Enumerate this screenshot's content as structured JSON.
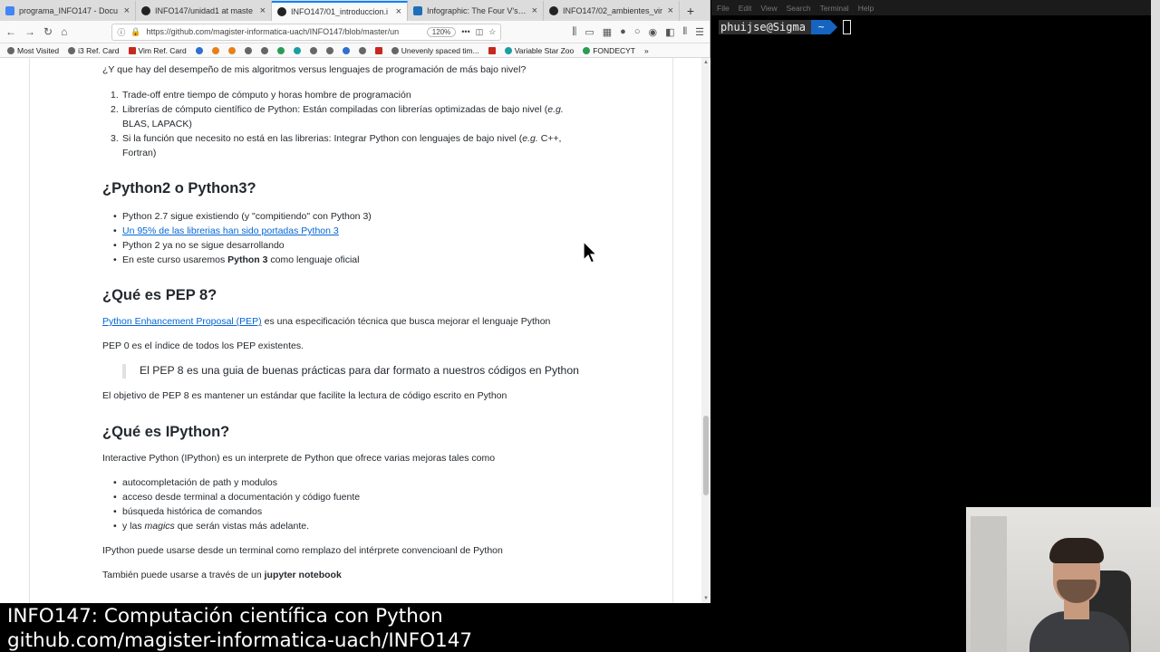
{
  "browser": {
    "tabs": [
      {
        "label": "programa_INFO147 - Docu",
        "favicon": "google-docs-icon",
        "active": false
      },
      {
        "label": "INFO147/unidad1 at maste",
        "favicon": "github-icon",
        "active": false
      },
      {
        "label": "INFO147/01_introduccion.i",
        "favicon": "github-icon",
        "active": true
      },
      {
        "label": "Infographic: The Four V's of",
        "favicon": "infographic-icon",
        "active": false
      },
      {
        "label": "INFO147/02_ambientes_vir",
        "favicon": "github-icon",
        "active": false
      }
    ],
    "new_tab": "+",
    "close_glyph": "×",
    "url": "https://github.com/magister-informatica-uach/INFO147/blob/master/un",
    "zoom": "120%",
    "bookmarks": [
      {
        "label": "Most Visited",
        "icon": "gear-icon"
      },
      {
        "label": "i3 Ref. Card",
        "icon": "globe-icon"
      },
      {
        "label": "Vim Ref. Card",
        "icon": "vim-icon"
      },
      {
        "label": "Unevenly spaced tim...",
        "icon": "wikipedia-icon"
      },
      {
        "label": "Variable Star Zoo",
        "icon": "zooniverse-icon"
      },
      {
        "label": "FONDECYT",
        "icon": "drive-icon"
      }
    ]
  },
  "article": {
    "intro_question": "¿Y que hay del desempeño de mis algoritmos versus lenguajes de programación de más bajo nivel?",
    "list1": {
      "item1": "Trade-off entre tiempo de cómputo y horas hombre de programación",
      "item2_a": "Librerías de cómputo científico de Python: Están compiladas con librerías optimizadas de bajo nivel (",
      "item2_eg": "e.g.",
      "item2_b": "BLAS, LAPACK)",
      "item3_a": "Si la función que necesito no está en las librerias: Integrar Python con lenguajes de bajo nivel (",
      "item3_eg": "e.g.",
      "item3_c": " C++,",
      "item3_b": "Fortran)"
    },
    "h_python": "¿Python2 o Python3?",
    "list2": {
      "item1": "Python 2.7 sigue existiendo (y \"compitiendo\" con Python 3)",
      "item2_link": "Un 95% de las librerias han sido portadas Python 3",
      "item3": "Python 2 ya no se sigue desarrollando",
      "item4_a": "En este curso usaremos ",
      "item4_bold": "Python 3",
      "item4_b": " como lenguaje oficial"
    },
    "h_pep": "¿Qué es PEP 8?",
    "pep_link": "Python Enhancement Proposal (PEP)",
    "pep_text": " es una especificación técnica que busca mejorar el lenguaje Python",
    "pep0": "PEP 0 es el índice de todos los PEP existentes.",
    "pep_quote": "El PEP 8 es una guia de buenas prácticas para dar formato a nuestros códigos en Python",
    "pep_goal": "El objetivo de PEP 8 es mantener un estándar que facilite la lectura de código escrito en Python",
    "h_ipython": "¿Qué es IPython?",
    "ipython_intro": "Interactive Python (IPython) es un interprete de Python que ofrece varias mejoras tales como",
    "list3": {
      "item1": "autocompletación de path y modulos",
      "item2": "acceso desde terminal a documentación y código fuente",
      "item3": "búsqueda histórica de comandos",
      "item4_a": "y las ",
      "item4_em": "magics",
      "item4_b": " que serán vistas más adelante."
    },
    "ipython_terminal": "IPython puede usarse desde un terminal como remplazo del intérprete convencioanl de Python",
    "ipython_jupyter_a": "También puede usarse a través de un ",
    "ipython_jupyter_bold": "jupyter notebook"
  },
  "terminal": {
    "menu": [
      "File",
      "Edit",
      "View",
      "Search",
      "Terminal",
      "Help"
    ],
    "prompt_user": "phuijse@Sigma",
    "prompt_dir": "~"
  },
  "caption": {
    "line1": "INFO147: Computación científica con Python",
    "line2": "github.com/magister-informatica-uach/INFO147"
  }
}
